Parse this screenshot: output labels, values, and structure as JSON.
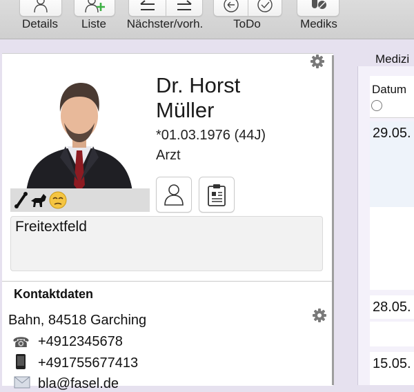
{
  "toolbar": {
    "details_label": "Details",
    "liste_label": "Liste",
    "next_prev_label": "Nächster/vorh.",
    "todo_label": "ToDo",
    "mediks_label": "Mediks"
  },
  "patient": {
    "name_line1": "Dr. Horst",
    "name_line2": "Müller",
    "birth": "*01.03.1976 (44J)",
    "profession": "Arzt",
    "freetext": "Freitextfeld"
  },
  "contact": {
    "title": "Kontaktdaten",
    "address": "Bahn, 84518 Garching",
    "phone": "+4912345678",
    "mobile": "+491755677413",
    "email": "bla@fasel.de"
  },
  "right_panel": {
    "title": "Medizi",
    "column_header": "Datum",
    "rows": [
      "29.05.",
      "28.05.",
      "15.05."
    ]
  },
  "icons": {
    "phone": "telephone-icon",
    "mobile": "mobile-phone-icon",
    "email": "envelope-icon",
    "settings": "gear-icon"
  },
  "colors": {
    "accent_green": "#3cb043",
    "window_bg": "#e6e1ef"
  }
}
